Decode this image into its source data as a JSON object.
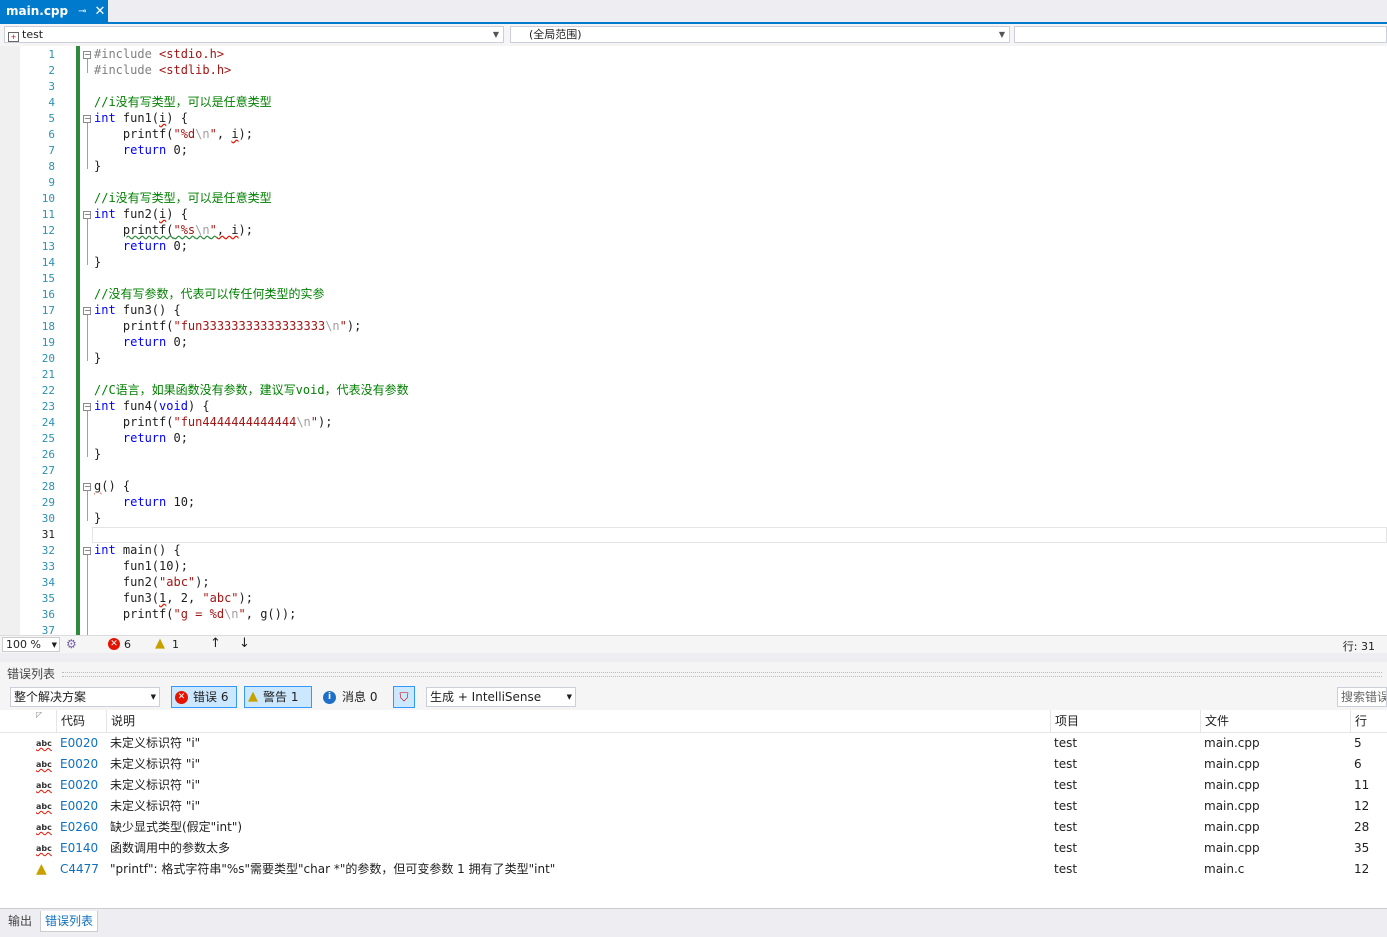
{
  "tab": {
    "title": "main.cpp",
    "pin": "⊸",
    "close": "✕"
  },
  "nav": {
    "project": "test",
    "scope": "(全局范围)"
  },
  "editor": {
    "lines": [
      {
        "n": "1"
      },
      {
        "n": "2"
      },
      {
        "n": "3"
      },
      {
        "n": "4"
      },
      {
        "n": "5"
      },
      {
        "n": "6"
      },
      {
        "n": "7"
      },
      {
        "n": "8"
      },
      {
        "n": "9"
      },
      {
        "n": "10"
      },
      {
        "n": "11"
      },
      {
        "n": "12"
      },
      {
        "n": "13"
      },
      {
        "n": "14"
      },
      {
        "n": "15"
      },
      {
        "n": "16"
      },
      {
        "n": "17"
      },
      {
        "n": "18"
      },
      {
        "n": "19"
      },
      {
        "n": "20"
      },
      {
        "n": "21"
      },
      {
        "n": "22"
      },
      {
        "n": "23"
      },
      {
        "n": "24"
      },
      {
        "n": "25"
      },
      {
        "n": "26"
      },
      {
        "n": "27"
      },
      {
        "n": "28"
      },
      {
        "n": "29"
      },
      {
        "n": "30"
      },
      {
        "n": "31"
      },
      {
        "n": "32"
      },
      {
        "n": "33"
      },
      {
        "n": "34"
      },
      {
        "n": "35"
      },
      {
        "n": "36"
      },
      {
        "n": "37"
      }
    ],
    "code": {
      "l1a": "#include ",
      "l1b": "<stdio.h>",
      "l2a": "#include ",
      "l2b": "<stdlib.h>",
      "l4": "//i没有写类型，可以是任意类型",
      "l5kw": "int",
      "l5a": " fun1(",
      "l5b": "i",
      "l5c": ") {",
      "l6a": "    printf(",
      "l6b": "\"%d",
      "l6c": "\\n",
      "l6d": "\"",
      "l6e": ", ",
      "l6f": "i",
      "l6g": ");",
      "l7kw": "    return",
      "l7a": " 0;",
      "l8": "}",
      "l10": "//i没有写类型，可以是任意类型",
      "l11kw": "int",
      "l11a": " fun2(",
      "l11b": "i",
      "l11c": ") {",
      "l12a": "    ",
      "l12b": "printf(",
      "l12c": "\"%s",
      "l12d": "\\n",
      "l12e": "\"",
      "l12f": ", i",
      "l12g": ");",
      "l13kw": "    return",
      "l13a": " 0;",
      "l14": "}",
      "l16": "//没有写参数，代表可以传任何类型的实参",
      "l17kw": "int",
      "l17a": " fun3() {",
      "l18a": "    printf(",
      "l18b": "\"fun33333333333333333",
      "l18c": "\\n",
      "l18d": "\"",
      "l18e": ");",
      "l19kw": "    return",
      "l19a": " 0;",
      "l20": "}",
      "l22": "//C语言，如果函数没有参数，建议写void，代表没有参数",
      "l23kw": "int",
      "l23a": " fun4(",
      "l23b": "void",
      "l23c": ") {",
      "l24a": "    printf(",
      "l24b": "\"fun4444444444444",
      "l24c": "\\n",
      "l24d": "\"",
      "l24e": ");",
      "l25kw": "    return",
      "l25a": " 0;",
      "l26": "}",
      "l28a": "g",
      "l28b": "() {",
      "l29kw": "    return",
      "l29a": " 10;",
      "l30": "}",
      "l32kw": "int",
      "l32a": " main() {",
      "l33": "    fun1(10);",
      "l34a": "    fun2(",
      "l34b": "\"abc\"",
      "l34c": ");",
      "l35a": "    fun3(",
      "l35b": "1",
      "l35c": ", 2, ",
      "l35d": "\"abc\"",
      "l35e": ");",
      "l36a": "    printf(",
      "l36b": "\"g = %d",
      "l36c": "\\n",
      "l36d": "\"",
      "l36e": ", g());"
    }
  },
  "status": {
    "zoom": "100 %",
    "errors": "6",
    "warnings": "1",
    "position": "行: 31"
  },
  "errorlist": {
    "title": "错误列表",
    "scope": "整个解决方案",
    "errors_btn": "错误 6",
    "warnings_btn": "警告 1",
    "messages_btn": "消息 0",
    "build_filter": "生成 + IntelliSense",
    "search": "搜索错误",
    "headers": {
      "code": "代码",
      "desc": "说明",
      "project": "项目",
      "file": "文件",
      "line": "行"
    },
    "rows": [
      {
        "icon": "abc",
        "code": "E0020",
        "desc": "未定义标识符 \"i\"",
        "project": "test",
        "file": "main.cpp",
        "line": "5"
      },
      {
        "icon": "abc",
        "code": "E0020",
        "desc": "未定义标识符 \"i\"",
        "project": "test",
        "file": "main.cpp",
        "line": "6"
      },
      {
        "icon": "abc",
        "code": "E0020",
        "desc": "未定义标识符 \"i\"",
        "project": "test",
        "file": "main.cpp",
        "line": "11"
      },
      {
        "icon": "abc",
        "code": "E0020",
        "desc": "未定义标识符 \"i\"",
        "project": "test",
        "file": "main.cpp",
        "line": "12"
      },
      {
        "icon": "abc",
        "code": "E0260",
        "desc": "缺少显式类型(假定\"int\")",
        "project": "test",
        "file": "main.cpp",
        "line": "28"
      },
      {
        "icon": "abc",
        "code": "E0140",
        "desc": "函数调用中的参数太多",
        "project": "test",
        "file": "main.cpp",
        "line": "35"
      },
      {
        "icon": "warn",
        "code": "C4477",
        "desc": "\"printf\": 格式字符串\"%s\"需要类型\"char *\"的参数，但可变参数 1 拥有了类型\"int\"",
        "project": "test",
        "file": "main.c",
        "line": "12"
      }
    ]
  },
  "bottom_tabs": {
    "output": "输出",
    "errorlist": "错误列表"
  }
}
